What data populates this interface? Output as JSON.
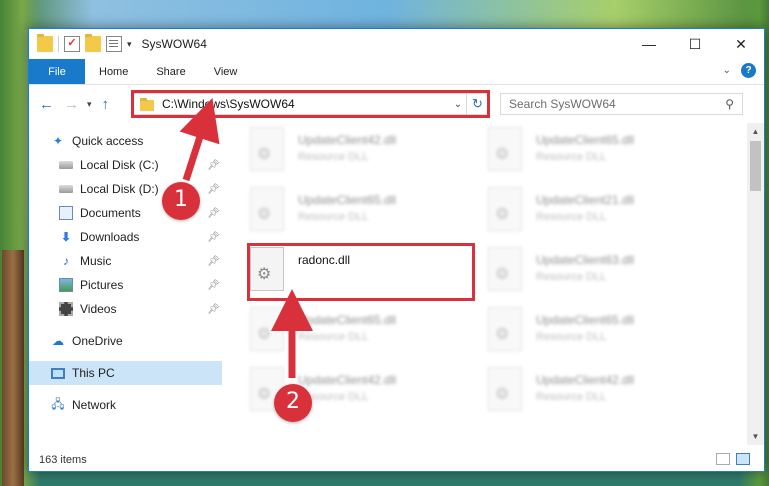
{
  "window": {
    "title": "SysWOW64",
    "controls": {
      "minimize": "—",
      "maximize": "☐",
      "close": "✕"
    }
  },
  "ribbon": {
    "tabs": [
      "File",
      "Home",
      "Share",
      "View"
    ],
    "help": "?"
  },
  "nav": {
    "back": "←",
    "forward": "→",
    "recent": "▾",
    "up": "↑",
    "address": "C:\\Windows\\SysWOW64",
    "refresh": "↻",
    "search_placeholder": "Search SysWOW64"
  },
  "sidebar": {
    "items": [
      {
        "label": "Quick access",
        "icon": "star-icon"
      },
      {
        "label": "Local Disk (C:)",
        "icon": "disk-icon",
        "pinned": true
      },
      {
        "label": "Local Disk (D:)",
        "icon": "disk-icon",
        "pinned": true
      },
      {
        "label": "Documents",
        "icon": "documents-icon",
        "pinned": true
      },
      {
        "label": "Downloads",
        "icon": "download-icon",
        "pinned": true
      },
      {
        "label": "Music",
        "icon": "music-icon",
        "pinned": true
      },
      {
        "label": "Pictures",
        "icon": "pictures-icon",
        "pinned": true
      },
      {
        "label": "Videos",
        "icon": "videos-icon",
        "pinned": true
      },
      {
        "label": "OneDrive",
        "icon": "onedrive-icon"
      },
      {
        "label": "This PC",
        "icon": "pc-icon",
        "selected": true
      },
      {
        "label": "Network",
        "icon": "network-icon"
      }
    ]
  },
  "files": {
    "left": [
      {
        "name": "UpdateClient42.dll",
        "type": "Resource DLL"
      },
      {
        "name": "UpdateClient65.dll",
        "type": "Resource DLL"
      },
      {
        "name": "radonc.dll",
        "type": ""
      },
      {
        "name": "UpdateClient65.dll",
        "type": "Resource DLL"
      },
      {
        "name": "UpdateClient42.dll",
        "type": "Resource DLL"
      }
    ],
    "right": [
      {
        "name": "UpdateClient65.dll",
        "type": "Resource DLL"
      },
      {
        "name": "UpdateClient21.dll",
        "type": "Resource DLL"
      },
      {
        "name": "UpdateClient63.dll",
        "type": "Resource DLL"
      },
      {
        "name": "UpdateClient65.dll",
        "type": "Resource DLL"
      },
      {
        "name": "UpdateClient42.dll",
        "type": "Resource DLL"
      }
    ]
  },
  "status": {
    "item_count": "163 items"
  },
  "annotations": {
    "step1": "1",
    "step2": "2",
    "color": "#d9313c"
  }
}
